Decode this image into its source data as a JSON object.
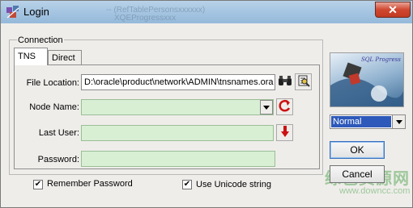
{
  "window": {
    "title": "Login",
    "close_label": "✕",
    "background_titles": [
      "-- (RefTablePersonsxxxxxx)",
      "XQEProgressxxx"
    ]
  },
  "connection": {
    "group_label": "Connection",
    "tabs": [
      {
        "label": "TNS",
        "selected": true
      },
      {
        "label": "Direct",
        "selected": false
      }
    ],
    "file_location": {
      "label": "File Location:",
      "value": "D:\\oracle\\product\\network\\ADMIN\\tnsnames.ora"
    },
    "node_name": {
      "label": "Node Name:",
      "value": ""
    },
    "last_user": {
      "label": "Last User:",
      "value": ""
    },
    "password": {
      "label": "Password:",
      "value": ""
    }
  },
  "options": {
    "remember_password": {
      "label": "Remember Password",
      "checked": true
    },
    "use_unicode": {
      "label": "Use Unicode string",
      "checked": true
    }
  },
  "side": {
    "logo_text": "SQL Progress",
    "mode": {
      "value": "Normal"
    },
    "ok_label": "OK",
    "cancel_label": "Cancel"
  },
  "watermark": {
    "text": "绿色资源网",
    "sub": "www.downcc.com"
  },
  "icons": {
    "app": "app-icon",
    "browse": "binoculars-icon",
    "open": "open-file-icon",
    "refresh": "refresh-icon",
    "down": "down-arrow-icon"
  },
  "colors": {
    "field_fill": "#d8efd4",
    "selection": "#2d59ba",
    "title_bar": "#a7c6e2",
    "close_button": "#c9432c",
    "refresh": "#cc1111"
  }
}
